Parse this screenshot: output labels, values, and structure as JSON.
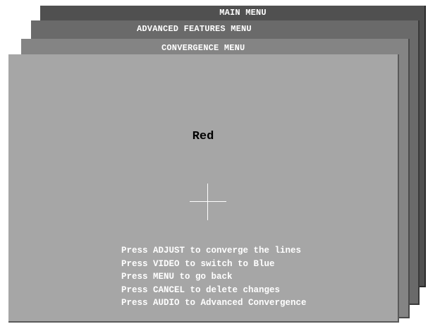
{
  "menus": {
    "main_title": "MAIN MENU",
    "advanced_title": "ADVANCED FEATURES MENU",
    "convergence_title": "CONVERGENCE MENU"
  },
  "convergence": {
    "current_color": "Red",
    "crosshair_icon": "crosshair-icon",
    "instructions": [
      "Press ADJUST to converge the lines",
      "Press VIDEO to switch to Blue",
      "Press MENU to go back",
      "Press CANCEL to delete changes",
      "Press AUDIO to Advanced Convergence"
    ]
  },
  "colors": {
    "main_panel": "#505050",
    "advanced_panel": "#6a6a6a",
    "convergence_panel": "#848484",
    "front_panel": "#a6a6a6",
    "text_light": "#ffffff",
    "text_dark": "#000000"
  }
}
